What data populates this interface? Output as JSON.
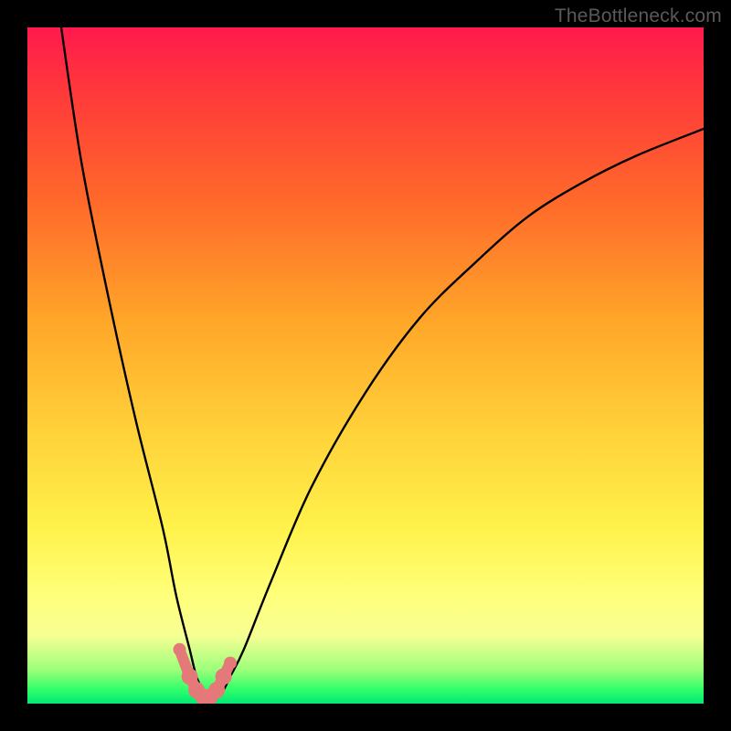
{
  "watermark": "TheBottleneck.com",
  "chart_data": {
    "type": "line",
    "title": "",
    "xlabel": "",
    "ylabel": "",
    "xlim": [
      0,
      100
    ],
    "ylim": [
      0,
      100
    ],
    "x": [
      5,
      8,
      12,
      16,
      20,
      22,
      24,
      25,
      26,
      27,
      28,
      29,
      30,
      32,
      36,
      42,
      50,
      58,
      66,
      74,
      82,
      90,
      100
    ],
    "values": [
      100,
      80,
      60,
      42,
      26,
      16,
      8,
      4,
      2,
      1,
      1,
      2,
      4,
      8,
      18,
      32,
      46,
      57,
      65,
      72,
      77,
      81,
      85
    ],
    "minimum_x": 27,
    "marker_points_x": [
      22.5,
      24,
      25,
      26,
      27,
      28,
      29,
      30
    ],
    "marker_points_y": [
      8,
      4,
      2,
      1,
      1,
      2,
      4,
      6
    ],
    "marker_color": "#e57878",
    "line_color": "#000000"
  }
}
